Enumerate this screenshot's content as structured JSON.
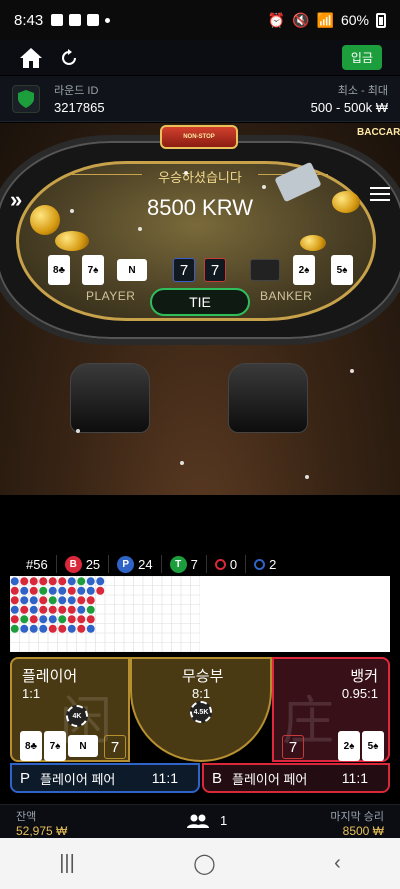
{
  "status": {
    "time": "8:43",
    "battery": "60%"
  },
  "header": {
    "deposit_label": "입금"
  },
  "round": {
    "id_label": "라운드 ID",
    "id_value": "3217865",
    "limit_label": "최소 - 최대",
    "limit_value": "500 - 500k ₩"
  },
  "game": {
    "logo_top": "NON-STOP",
    "logo_main": "BACCARAT",
    "win_title": "우승하셨습니다",
    "win_amount": "8500 KRW",
    "player_label": "PLAYER",
    "banker_label": "BANKER",
    "tie_label": "TIE",
    "player_score": "7",
    "banker_score": "7",
    "player_cards": [
      "8♣",
      "7♠",
      "N"
    ],
    "banker_cards": [
      "2♠",
      "5♠"
    ]
  },
  "stats": {
    "round_no": "#56",
    "banker": "25",
    "player": "24",
    "tie": "7",
    "banker_pair": "0",
    "player_pair": "2"
  },
  "bets": {
    "player_name": "플레이어",
    "player_odds": "1:1",
    "tie_name": "무승부",
    "tie_odds": "8:1",
    "banker_name": "뱅커",
    "banker_odds": "0.95:1",
    "player_watermark": "闲",
    "banker_watermark": "庄",
    "player_chip": "4K",
    "tie_chip": "4.5K",
    "player_total": "7",
    "banker_total": "7",
    "player_pair_letter": "P",
    "player_pair_label": "플레이어 페어",
    "player_pair_odds": "11:1",
    "banker_pair_letter": "B",
    "banker_pair_label": "플레이어 페어",
    "banker_pair_odds": "11:1"
  },
  "footer": {
    "balance_label": "잔액",
    "balance_value": "52,975 ₩",
    "players_count": "1",
    "last_win_label": "마지막 승리",
    "last_win_value": "8500 ₩"
  },
  "colors": {
    "banker": "#d9283a",
    "player": "#2f63c8",
    "tie": "#1d9e3c",
    "gold": "#c7a24a"
  }
}
